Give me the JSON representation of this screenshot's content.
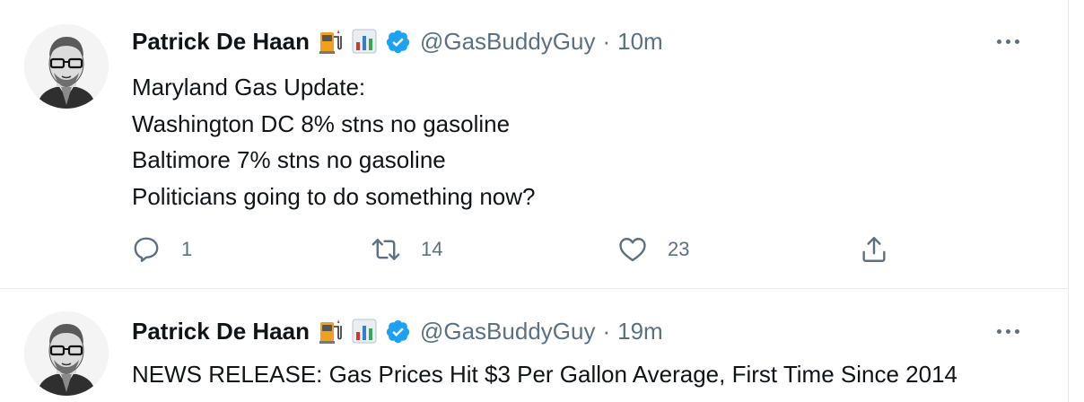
{
  "tweets": [
    {
      "author_name": "Patrick De Haan",
      "emoji_icons": [
        "fuel-pump-icon",
        "bar-chart-icon"
      ],
      "verified": true,
      "handle": "@GasBuddyGuy",
      "separator": "·",
      "time": "10m",
      "text_lines": [
        "Maryland Gas Update:",
        "Washington DC 8% stns no gasoline",
        "Baltimore 7% stns no gasoline",
        "Politicians going to do something now?"
      ],
      "actions": {
        "reply_count": "1",
        "retweet_count": "14",
        "like_count": "23"
      }
    },
    {
      "author_name": "Patrick De Haan",
      "emoji_icons": [
        "fuel-pump-icon",
        "bar-chart-icon"
      ],
      "verified": true,
      "handle": "@GasBuddyGuy",
      "separator": "·",
      "time": "19m",
      "text_lines": [
        "NEWS RELEASE: Gas Prices Hit $3 Per Gallon Average, First Time Since 2014"
      ]
    }
  ],
  "colors": {
    "text_primary": "#0f1419",
    "text_secondary": "#5b7083",
    "verified_blue": "#1da1f2",
    "divider": "#e6ecf0"
  }
}
